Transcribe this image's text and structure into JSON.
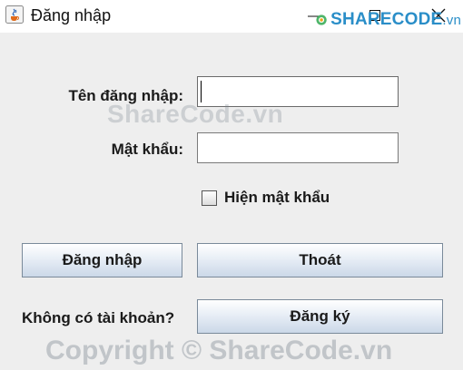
{
  "window": {
    "title": "Đăng nhập",
    "icon": "java-cup-icon"
  },
  "form": {
    "username_label": "Tên đăng nhập:",
    "username_value": "",
    "password_label": "Mật khẩu:",
    "password_value": "",
    "show_password_label": "Hiện mật khẩu",
    "show_password_checked": false,
    "login_button": "Đăng nhập",
    "exit_button": "Thoát",
    "no_account_label": "Không có tài khoản?",
    "register_button": "Đăng ký"
  },
  "watermark": {
    "logo_main": "SHARECODE",
    "logo_suffix": ".vn",
    "center_text": "ShareCode.vn",
    "copyright_text": "Copyright © ShareCode.vn",
    "brand_color": "#2a8ec8"
  }
}
